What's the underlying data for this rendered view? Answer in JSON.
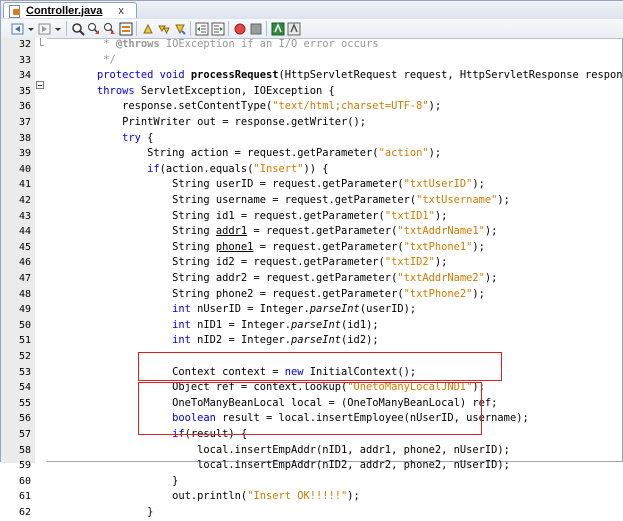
{
  "tab": {
    "title": "Controller.java",
    "close": "x"
  },
  "toolbar": {
    "buttons": [
      "back-icon",
      "dropdown-icon",
      "forward-icon",
      "dropdown-icon",
      "find-icon",
      "prev-occurrence-icon",
      "next-occurrence-icon",
      "toggle-highlight-icon",
      "prev-bookmark-icon",
      "next-bookmark-icon",
      "toggle-bookmark-icon",
      "shift-left-icon",
      "shift-right-icon",
      "record-macro-icon",
      "stop-macro-icon",
      "comment-icon",
      "uncomment-icon"
    ]
  },
  "lines": [
    {
      "n": "32",
      "segs": [
        {
          "t": "         * ",
          "c": "cmt"
        },
        {
          "t": "@throws",
          "c": "cmt bold"
        },
        {
          "t": " IOException if an I/O error occurs",
          "c": "cmt"
        }
      ]
    },
    {
      "n": "33",
      "segs": [
        {
          "t": "         */",
          "c": "cmt"
        }
      ]
    },
    {
      "n": "34",
      "segs": [
        {
          "t": "        "
        },
        {
          "t": "protected void",
          "c": "kw"
        },
        {
          "t": " "
        },
        {
          "t": "processRequest",
          "c": "bold"
        },
        {
          "t": "(HttpServletRequest request, HttpServletResponse response)"
        }
      ]
    },
    {
      "n": "35",
      "segs": [
        {
          "t": "        "
        },
        {
          "t": "throws",
          "c": "kw"
        },
        {
          "t": " ServletException, IOException {"
        }
      ]
    },
    {
      "n": "36",
      "segs": [
        {
          "t": "            response.setContentType("
        },
        {
          "t": "\"text/html;charset=UTF-8\"",
          "c": "str"
        },
        {
          "t": ");"
        }
      ]
    },
    {
      "n": "37",
      "segs": [
        {
          "t": "            PrintWriter out = response.getWriter();"
        }
      ]
    },
    {
      "n": "38",
      "segs": [
        {
          "t": "            "
        },
        {
          "t": "try",
          "c": "kw"
        },
        {
          "t": " {"
        }
      ]
    },
    {
      "n": "39",
      "segs": [
        {
          "t": "                String action = request.getParameter("
        },
        {
          "t": "\"action\"",
          "c": "str"
        },
        {
          "t": ");"
        }
      ]
    },
    {
      "n": "40",
      "segs": [
        {
          "t": "                "
        },
        {
          "t": "if",
          "c": "kw"
        },
        {
          "t": "(action.equals("
        },
        {
          "t": "\"Insert\"",
          "c": "str"
        },
        {
          "t": ")) {"
        }
      ]
    },
    {
      "n": "41",
      "segs": [
        {
          "t": "                    String userID = request.getParameter("
        },
        {
          "t": "\"txtUserID\"",
          "c": "str"
        },
        {
          "t": ");"
        }
      ]
    },
    {
      "n": "42",
      "segs": [
        {
          "t": "                    String username = request.getParameter("
        },
        {
          "t": "\"txtUsername\"",
          "c": "str"
        },
        {
          "t": ");"
        }
      ]
    },
    {
      "n": "43",
      "segs": [
        {
          "t": "                    String id1 = request.getParameter("
        },
        {
          "t": "\"txtID1\"",
          "c": "str"
        },
        {
          "t": ");"
        }
      ]
    },
    {
      "n": "44",
      "segs": [
        {
          "t": "                    String "
        },
        {
          "t": "addr1",
          "c": "ul"
        },
        {
          "t": " = request.getParameter("
        },
        {
          "t": "\"txtAddrName1\"",
          "c": "str"
        },
        {
          "t": ");"
        }
      ]
    },
    {
      "n": "45",
      "segs": [
        {
          "t": "                    String "
        },
        {
          "t": "phone1",
          "c": "ul"
        },
        {
          "t": " = request.getParameter("
        },
        {
          "t": "\"txtPhone1\"",
          "c": "str"
        },
        {
          "t": ");"
        }
      ]
    },
    {
      "n": "46",
      "segs": [
        {
          "t": "                    String id2 = request.getParameter("
        },
        {
          "t": "\"txtID2\"",
          "c": "str"
        },
        {
          "t": ");"
        }
      ]
    },
    {
      "n": "47",
      "segs": [
        {
          "t": "                    String addr2 = request.getParameter("
        },
        {
          "t": "\"txtAddrName2\"",
          "c": "str"
        },
        {
          "t": ");"
        }
      ]
    },
    {
      "n": "48",
      "segs": [
        {
          "t": "                    String phone2 = request.getParameter("
        },
        {
          "t": "\"txtPhone2\"",
          "c": "str"
        },
        {
          "t": ");"
        }
      ]
    },
    {
      "n": "49",
      "segs": [
        {
          "t": "                    "
        },
        {
          "t": "int",
          "c": "kw"
        },
        {
          "t": " nUserID = Integer."
        },
        {
          "t": "parseInt",
          "c": "it"
        },
        {
          "t": "(userID);"
        }
      ]
    },
    {
      "n": "50",
      "segs": [
        {
          "t": "                    "
        },
        {
          "t": "int",
          "c": "kw"
        },
        {
          "t": " nID1 = Integer."
        },
        {
          "t": "parseInt",
          "c": "it"
        },
        {
          "t": "(id1);"
        }
      ]
    },
    {
      "n": "51",
      "segs": [
        {
          "t": "                    "
        },
        {
          "t": "int",
          "c": "kw"
        },
        {
          "t": " nID2 = Integer."
        },
        {
          "t": "parseInt",
          "c": "it"
        },
        {
          "t": "(id2);"
        }
      ]
    },
    {
      "n": "52",
      "segs": [
        {
          "t": ""
        }
      ]
    },
    {
      "n": "53",
      "segs": [
        {
          "t": "                    Context context = "
        },
        {
          "t": "new",
          "c": "kw"
        },
        {
          "t": " InitialContext();"
        }
      ]
    },
    {
      "n": "54",
      "segs": [
        {
          "t": "                    Object ref = context.lookup("
        },
        {
          "t": "\"OnetoManyLocalJNDI\"",
          "c": "str"
        },
        {
          "t": ");"
        }
      ]
    },
    {
      "n": "55",
      "segs": [
        {
          "t": "                    OneToManyBeanLocal local = (OneToManyBeanLocal) ref;"
        }
      ]
    },
    {
      "n": "56",
      "segs": [
        {
          "t": "                    "
        },
        {
          "t": "boolean",
          "c": "kw"
        },
        {
          "t": " result = local.insertEmployee(nUserID, username);"
        }
      ]
    },
    {
      "n": "57",
      "segs": [
        {
          "t": "                    "
        },
        {
          "t": "if",
          "c": "kw"
        },
        {
          "t": "(result) {"
        }
      ]
    },
    {
      "n": "58",
      "segs": [
        {
          "t": "                        local.insertEmpAddr(nID1, addr1, phone2, nUserID);"
        }
      ]
    },
    {
      "n": "59",
      "segs": [
        {
          "t": "                        local.insertEmpAddr(nID2, addr2, phone2, nUserID);"
        }
      ]
    },
    {
      "n": "60",
      "segs": [
        {
          "t": "                    }"
        }
      ]
    },
    {
      "n": "61",
      "segs": [
        {
          "t": "                    out.println("
        },
        {
          "t": "\"Insert OK!!!!!\"",
          "c": "str"
        },
        {
          "t": ");"
        }
      ]
    },
    {
      "n": "62",
      "segs": [
        {
          "t": "                }"
        }
      ]
    }
  ]
}
